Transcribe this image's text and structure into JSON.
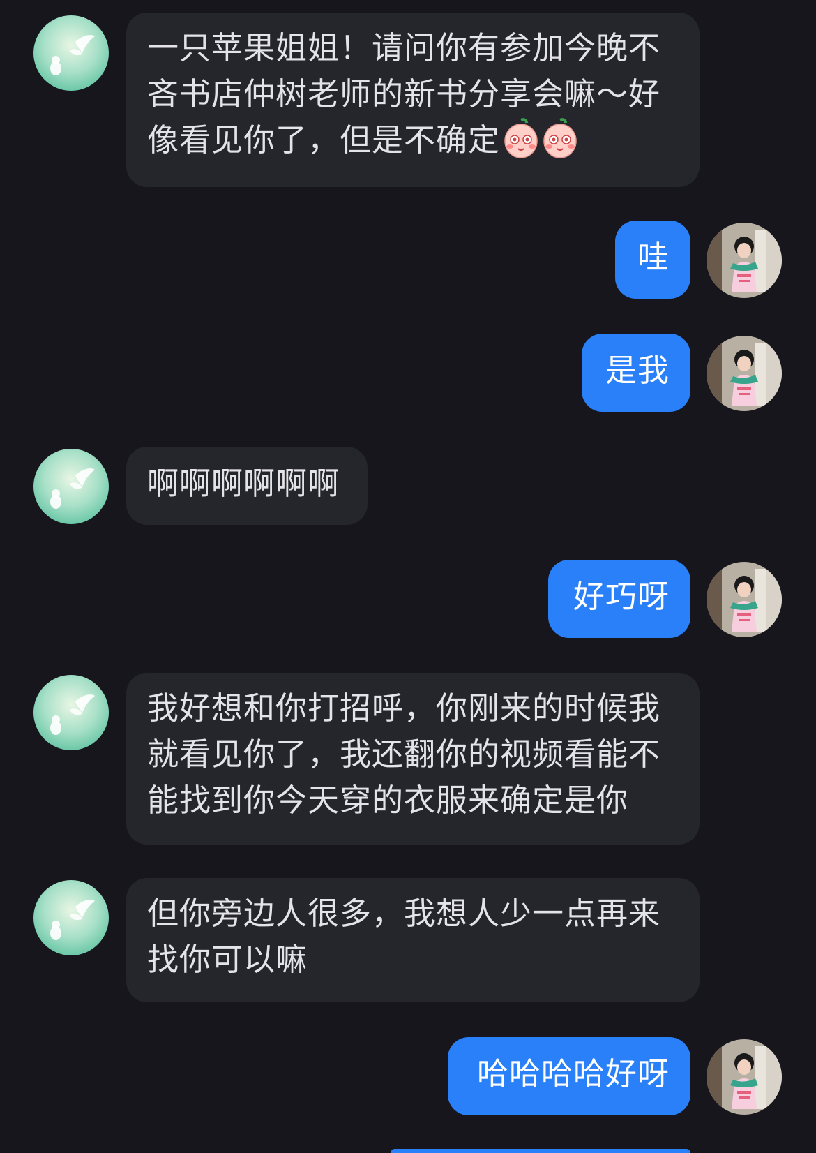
{
  "messages": [
    {
      "side": "left",
      "text": "一只苹果姐姐！请问你有参加今晚不吝书店仲树老师的新书分享会嘛～好像看见你了，但是不确定",
      "emojis": [
        "blush-face-emoji",
        "blush-face-emoji"
      ]
    },
    {
      "side": "right",
      "text": "哇"
    },
    {
      "side": "right",
      "text": "是我"
    },
    {
      "side": "left",
      "text": "啊啊啊啊啊啊"
    },
    {
      "side": "right",
      "text": "好巧呀"
    },
    {
      "side": "left",
      "text": "我好想和你打招呼，你刚来的时候我就看见你了，我还翻你的视频看能不能找到你今天穿的衣服来确定是你"
    },
    {
      "side": "left",
      "text": "但你旁边人很多，我想人少一点再来找你可以嘛"
    },
    {
      "side": "right",
      "text": "哈哈哈哈好呀"
    }
  ],
  "colors": {
    "background": "#16161c",
    "incoming_bubble": "#25252c",
    "outgoing_bubble": "#2a80f8"
  }
}
